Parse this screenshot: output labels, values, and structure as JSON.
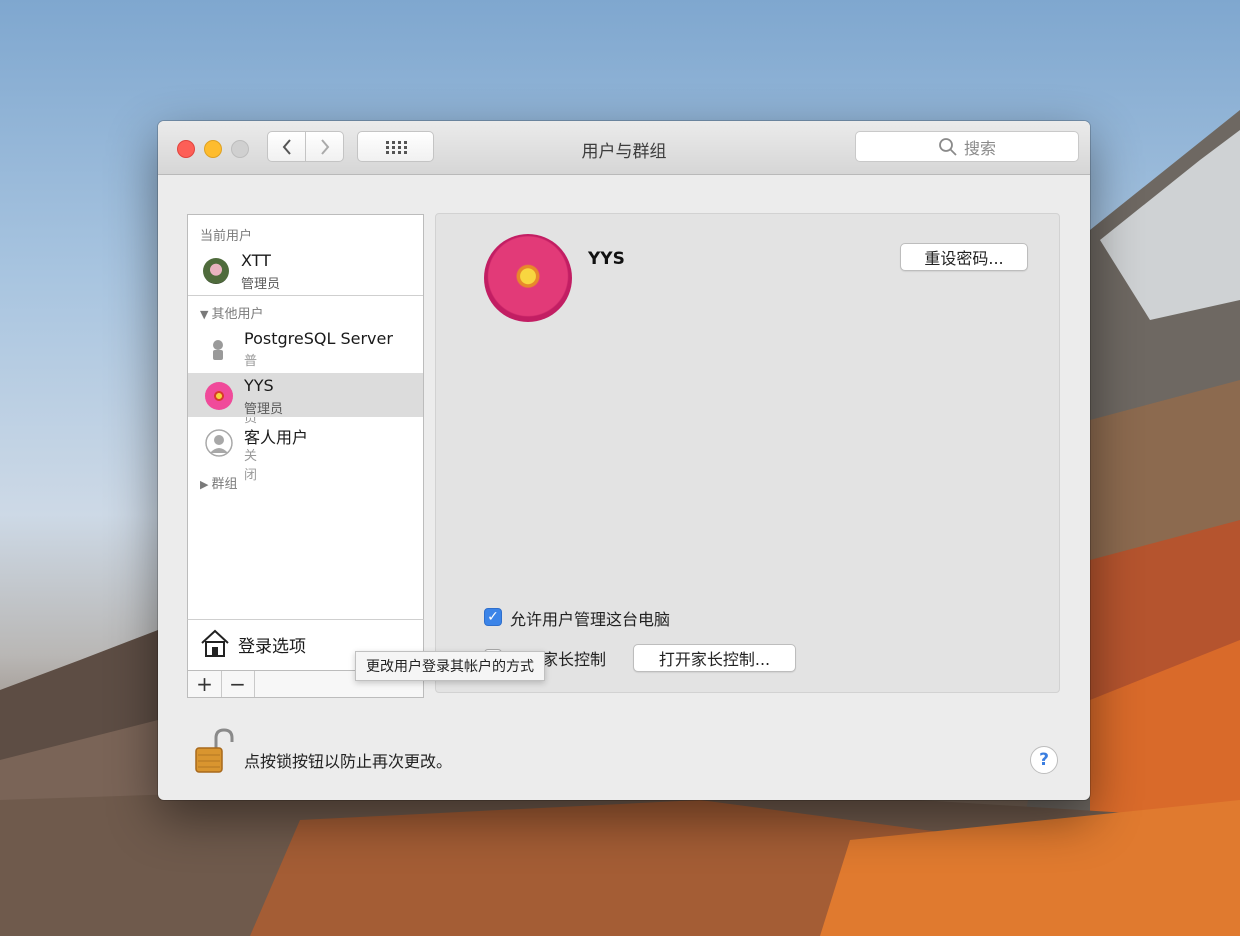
{
  "window": {
    "title": "用户与群组",
    "search_placeholder": "搜索"
  },
  "sidebar": {
    "current_users_header": "当前用户",
    "current_user": {
      "name": "XTT",
      "role": "管理员"
    },
    "other_users_header": "其他用户",
    "other_users": [
      {
        "name": "PostgreSQL Server",
        "role": "普通成员"
      },
      {
        "name": "YYS",
        "role": "管理员"
      },
      {
        "name": "客人用户",
        "role": "关闭"
      }
    ],
    "groups_label": "群组",
    "login_options": "登录选项",
    "add_symbol": "+",
    "remove_symbol": "−"
  },
  "main": {
    "user_name": "YYS",
    "reset_password_button": "重设密码...",
    "allow_admin_label": "允许用户管理这台电脑",
    "allow_admin_checked": true,
    "parental_controls_label": "启用家长控制",
    "parental_controls_checked": false,
    "open_parental_controls_button": "打开家长控制..."
  },
  "tooltip": "更改用户登录其帐户的方式",
  "footer": {
    "lock_text": "点按锁按钮以防止再次更改。",
    "help_symbol": "?"
  },
  "colors": {
    "accent": "#3b84e8",
    "selection": "#dcdcdc"
  }
}
